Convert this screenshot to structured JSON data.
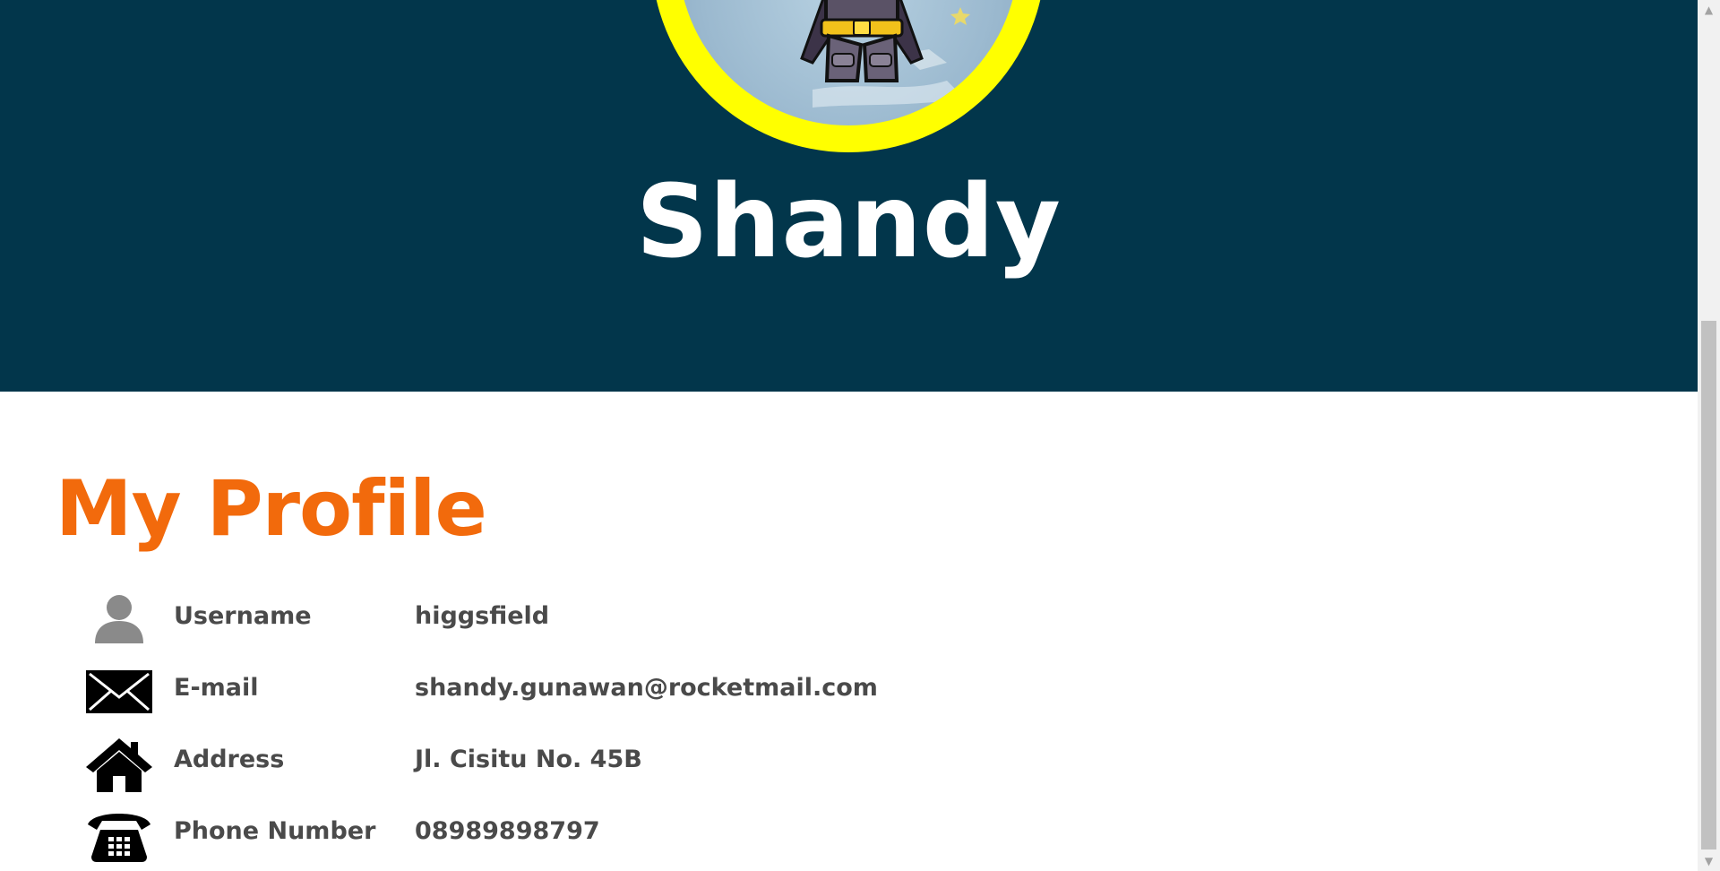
{
  "header": {
    "name": "Shandy"
  },
  "profile": {
    "title": "My Profile",
    "rows": [
      {
        "icon": "user-icon",
        "label": "Username",
        "value": "higgsfield"
      },
      {
        "icon": "envelope-icon",
        "label": "E-mail",
        "value": "shandy.gunawan@rocketmail.com"
      },
      {
        "icon": "home-icon",
        "label": "Address",
        "value": "Jl. Cisitu No. 45B"
      },
      {
        "icon": "telephone-icon",
        "label": "Phone Number",
        "value": "08989898797"
      }
    ]
  },
  "colors": {
    "hero_background": "#02364b",
    "avatar_ring": "#ffff00",
    "title": "#f26a0c",
    "text": "#4a4a4a"
  },
  "scrollbar": {
    "up_arrow": "▲",
    "down_arrow": "▼"
  }
}
